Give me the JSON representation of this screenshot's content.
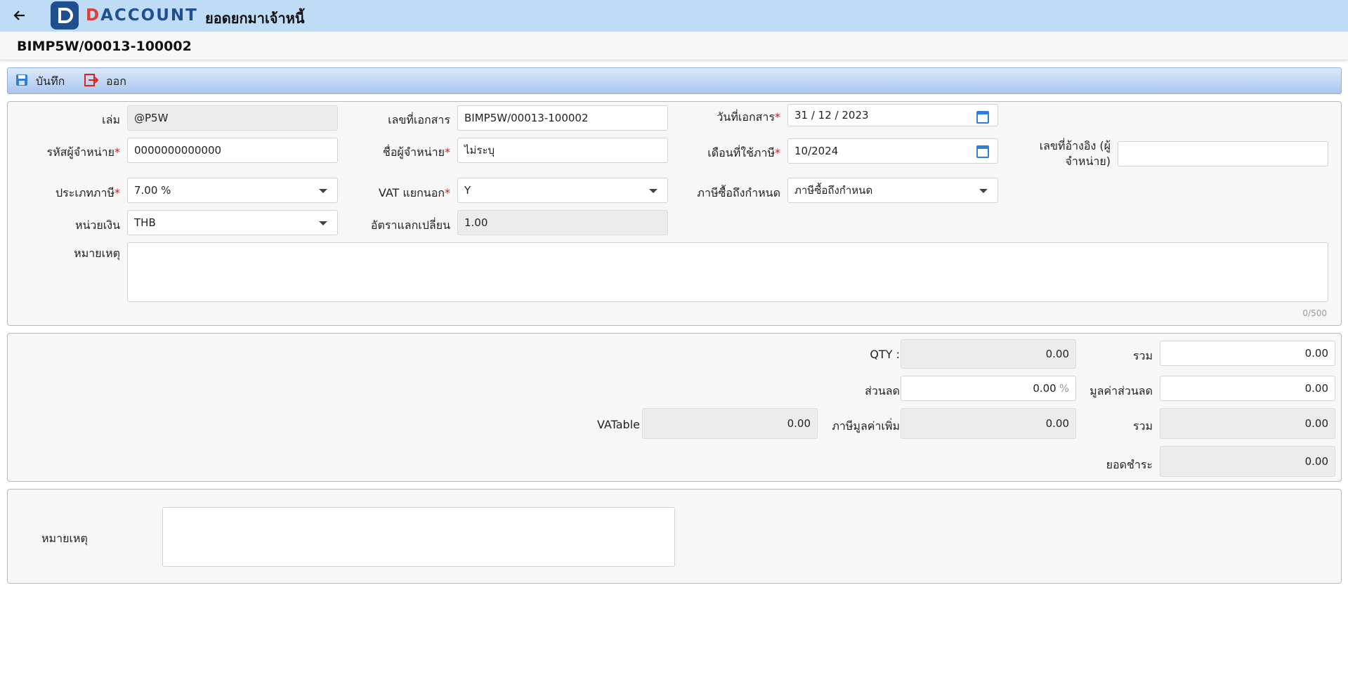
{
  "header": {
    "app_logo_text_d": "D",
    "app_logo_text_rest": "ACCOUNT",
    "title": "ยอดยกมาเจ้าหนี้"
  },
  "document": {
    "number": "BIMP5W/00013-100002"
  },
  "toolbar": {
    "save_label": "บันทึก",
    "exit_label": "ออก"
  },
  "form": {
    "book_label": "เล่ม",
    "book_value": "@P5W",
    "doc_no_label": "เลขที่เอกสาร",
    "doc_no_value": "BIMP5W/00013-100002",
    "doc_date_label": "วันที่เอกสาร",
    "doc_date_value": "31 / 12 /  2023",
    "vendor_code_label": "รหัสผู้จำหน่าย",
    "vendor_code_value": "0000000000000",
    "vendor_name_label": "ชื่อผู้จำหน่าย",
    "vendor_name_value": "ไม่ระบุ",
    "tax_month_label": "เดือนที่ใช้ภาษี",
    "tax_month_value": "10/2024",
    "ref_no_label_1": "เลขที่อ้างอิง (ผู้",
    "ref_no_label_2": "จำหน่าย)",
    "ref_no_value": "",
    "tax_type_label": "ประเภทภาษี",
    "tax_type_value": "7.00 %",
    "vat_separate_label": "VAT แยกนอก",
    "vat_separate_value": "Y",
    "purchase_tax_label": "ภาษีซื้อถึงกำหนด",
    "purchase_tax_value": "ภาษีซื้อถึงกำหนด",
    "currency_label": "หน่วยเงิน",
    "currency_value": "THB",
    "exchange_rate_label": "อัตราแลกเปลี่ยน",
    "exchange_rate_value": "1.00",
    "remark_label": "หมายเหตุ",
    "remark_value": "",
    "remark_counter": "0/500",
    "required_mark": "*"
  },
  "totals": {
    "qty_label": "QTY :",
    "qty_value": "0.00",
    "sum_label": "รวม",
    "sum_value": "0.00",
    "discount_label": "ส่วนลด",
    "discount_value": "0.00",
    "discount_unit": "%",
    "discount_amount_label": "มูลค่าส่วนลด",
    "discount_amount_value": "0.00",
    "vatable_label": "VATable",
    "vatable_value": "0.00",
    "vat_label": "ภาษีมูลค่าเพิ่ม",
    "vat_value": "0.00",
    "total_label": "รวม",
    "total_value": "0.00",
    "payment_label": "ยอดชำระ",
    "payment_value": "0.00"
  },
  "footer": {
    "remark_label": "หมายเหตุ",
    "remark_value": ""
  },
  "colors": {
    "header_bg": "#bfdcf6",
    "brand_blue": "#1f4f8f",
    "brand_red": "#e23b3b",
    "required": "#dd1111",
    "icon_blue": "#2f7fd6"
  }
}
